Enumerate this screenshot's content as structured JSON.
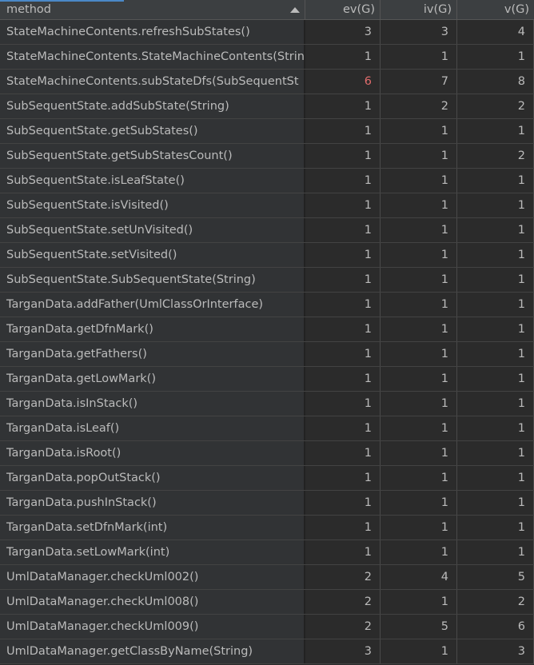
{
  "columns": {
    "method": "method",
    "ev": "ev(G)",
    "iv": "iv(G)",
    "v": "v(G)"
  },
  "colors": {
    "background": "#2b2b2b",
    "header": "#3c3f41",
    "highlight": "#e06c6c",
    "accent": "#4a88c7"
  },
  "rows": [
    {
      "method": "StateMachineContents.refreshSubStates()",
      "ev": "3",
      "iv": "3",
      "v": "4"
    },
    {
      "method": "StateMachineContents.StateMachineContents(String",
      "ev": "1",
      "iv": "1",
      "v": "1"
    },
    {
      "method": "StateMachineContents.subStateDfs(SubSequentSt",
      "ev": "6",
      "iv": "7",
      "v": "8",
      "ev_highlight": true
    },
    {
      "method": "SubSequentState.addSubState(String)",
      "ev": "1",
      "iv": "2",
      "v": "2"
    },
    {
      "method": "SubSequentState.getSubStates()",
      "ev": "1",
      "iv": "1",
      "v": "1"
    },
    {
      "method": "SubSequentState.getSubStatesCount()",
      "ev": "1",
      "iv": "1",
      "v": "2"
    },
    {
      "method": "SubSequentState.isLeafState()",
      "ev": "1",
      "iv": "1",
      "v": "1"
    },
    {
      "method": "SubSequentState.isVisited()",
      "ev": "1",
      "iv": "1",
      "v": "1"
    },
    {
      "method": "SubSequentState.setUnVisited()",
      "ev": "1",
      "iv": "1",
      "v": "1"
    },
    {
      "method": "SubSequentState.setVisited()",
      "ev": "1",
      "iv": "1",
      "v": "1"
    },
    {
      "method": "SubSequentState.SubSequentState(String)",
      "ev": "1",
      "iv": "1",
      "v": "1"
    },
    {
      "method": "TarganData.addFather(UmlClassOrInterface)",
      "ev": "1",
      "iv": "1",
      "v": "1"
    },
    {
      "method": "TarganData.getDfnMark()",
      "ev": "1",
      "iv": "1",
      "v": "1"
    },
    {
      "method": "TarganData.getFathers()",
      "ev": "1",
      "iv": "1",
      "v": "1"
    },
    {
      "method": "TarganData.getLowMark()",
      "ev": "1",
      "iv": "1",
      "v": "1"
    },
    {
      "method": "TarganData.isInStack()",
      "ev": "1",
      "iv": "1",
      "v": "1"
    },
    {
      "method": "TarganData.isLeaf()",
      "ev": "1",
      "iv": "1",
      "v": "1"
    },
    {
      "method": "TarganData.isRoot()",
      "ev": "1",
      "iv": "1",
      "v": "1"
    },
    {
      "method": "TarganData.popOutStack()",
      "ev": "1",
      "iv": "1",
      "v": "1"
    },
    {
      "method": "TarganData.pushInStack()",
      "ev": "1",
      "iv": "1",
      "v": "1"
    },
    {
      "method": "TarganData.setDfnMark(int)",
      "ev": "1",
      "iv": "1",
      "v": "1"
    },
    {
      "method": "TarganData.setLowMark(int)",
      "ev": "1",
      "iv": "1",
      "v": "1"
    },
    {
      "method": "UmlDataManager.checkUml002()",
      "ev": "2",
      "iv": "4",
      "v": "5"
    },
    {
      "method": "UmlDataManager.checkUml008()",
      "ev": "2",
      "iv": "1",
      "v": "2"
    },
    {
      "method": "UmlDataManager.checkUml009()",
      "ev": "2",
      "iv": "5",
      "v": "6"
    },
    {
      "method": "UmlDataManager.getClassByName(String)",
      "ev": "3",
      "iv": "1",
      "v": "3"
    }
  ]
}
